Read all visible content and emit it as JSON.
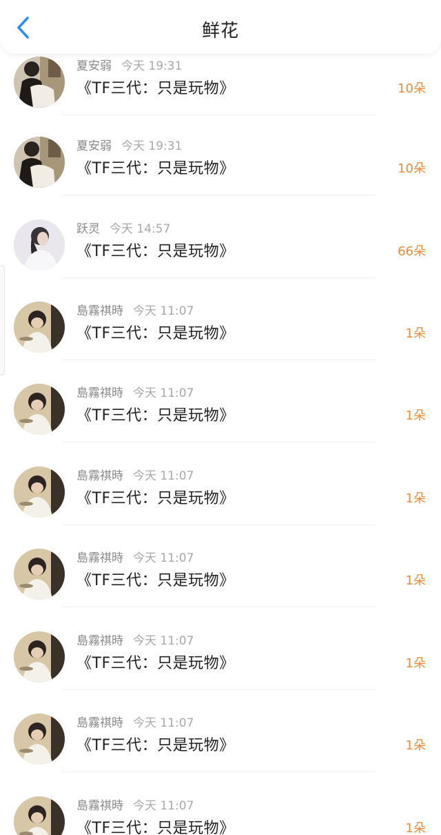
{
  "header": {
    "title": "鲜花"
  },
  "accent": "#f08a38",
  "items": [
    {
      "name": "夏安弱",
      "time": "今天 19:31",
      "title": "《TF三代：只是玩物》",
      "count": "10朵",
      "avatar": "avatar-drawing"
    },
    {
      "name": "夏安弱",
      "time": "今天 19:31",
      "title": "《TF三代：只是玩物》",
      "count": "10朵",
      "avatar": "avatar-drawing"
    },
    {
      "name": "跃灵",
      "time": "今天 14:57",
      "title": "《TF三代：只是玩物》",
      "count": "66朵",
      "avatar": "avatar-girl"
    },
    {
      "name": "島霧祺時",
      "time": "今天 11:07",
      "title": "《TF三代：只是玩物》",
      "count": "1朵",
      "avatar": "avatar-boy"
    },
    {
      "name": "島霧祺時",
      "time": "今天 11:07",
      "title": "《TF三代：只是玩物》",
      "count": "1朵",
      "avatar": "avatar-boy"
    },
    {
      "name": "島霧祺時",
      "time": "今天 11:07",
      "title": "《TF三代：只是玩物》",
      "count": "1朵",
      "avatar": "avatar-boy"
    },
    {
      "name": "島霧祺時",
      "time": "今天 11:07",
      "title": "《TF三代：只是玩物》",
      "count": "1朵",
      "avatar": "avatar-boy"
    },
    {
      "name": "島霧祺時",
      "time": "今天 11:07",
      "title": "《TF三代：只是玩物》",
      "count": "1朵",
      "avatar": "avatar-boy"
    },
    {
      "name": "島霧祺時",
      "time": "今天 11:07",
      "title": "《TF三代：只是玩物》",
      "count": "1朵",
      "avatar": "avatar-boy"
    },
    {
      "name": "島霧祺時",
      "time": "今天 11:07",
      "title": "《TF三代：只是玩物》",
      "count": "1朵",
      "avatar": "avatar-boy"
    }
  ]
}
